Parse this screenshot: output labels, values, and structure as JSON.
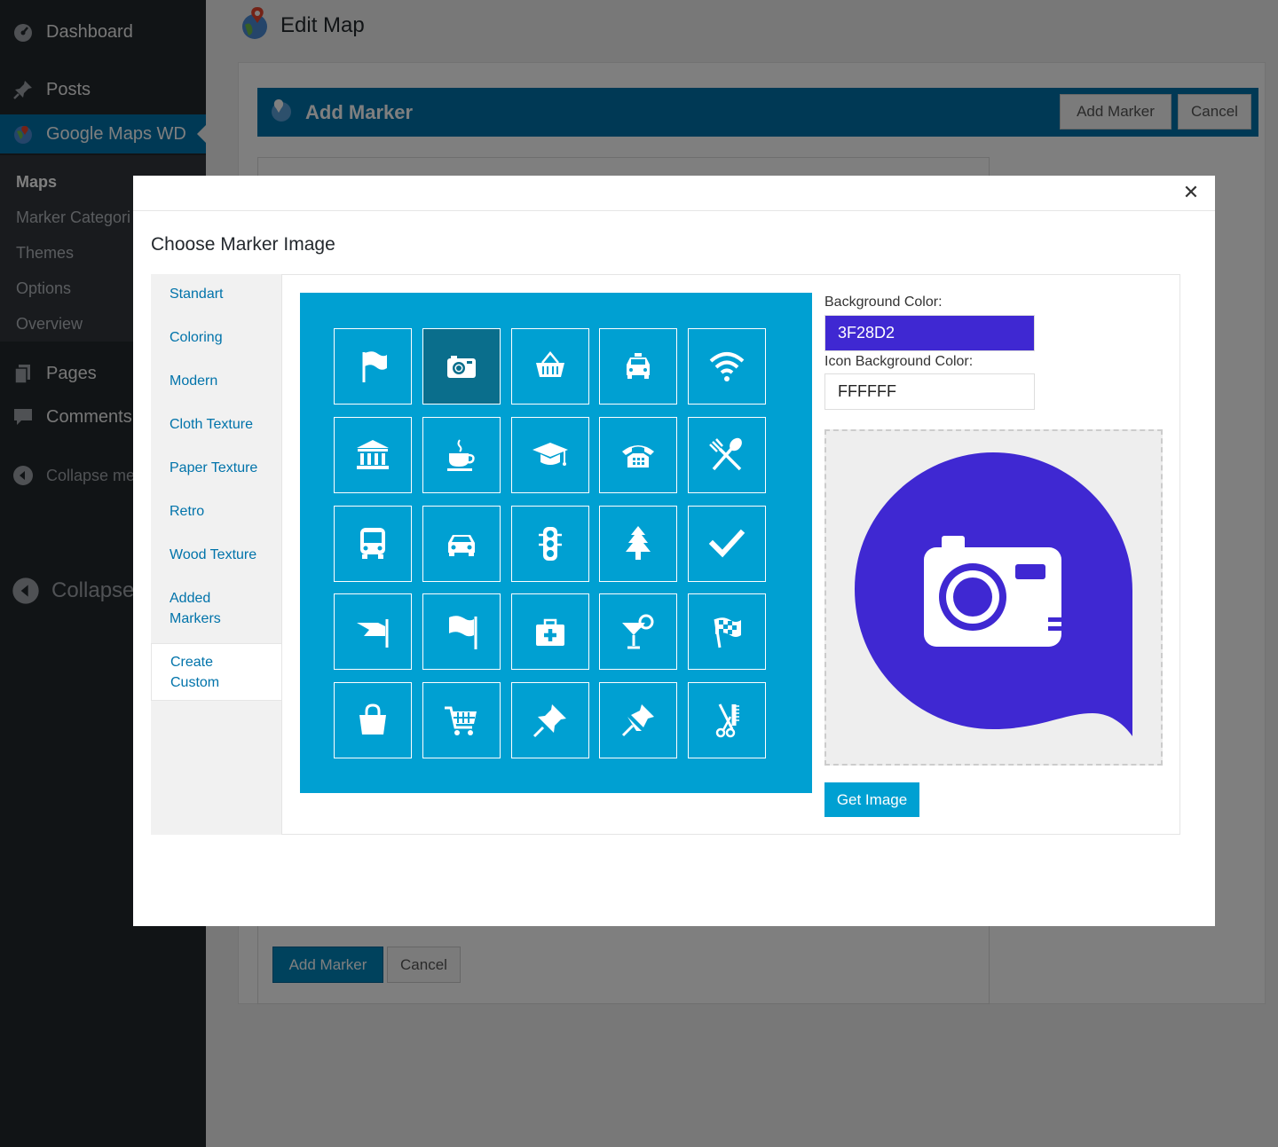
{
  "sidebar": {
    "items": [
      {
        "label": "Dashboard",
        "icon": "dashboard-icon"
      },
      {
        "label": "Posts",
        "icon": "pin-icon"
      },
      {
        "label": "Google Maps WD",
        "icon": "globe-icon"
      },
      {
        "label": "Pages",
        "icon": "pages-icon"
      },
      {
        "label": "Comments",
        "icon": "comment-icon"
      },
      {
        "label": "Collapse me",
        "icon": "collapse-icon"
      },
      {
        "label": "Collapse",
        "icon": "collapse-icon"
      }
    ],
    "submenu": [
      "Maps",
      "Marker Categori",
      "Themes",
      "Options",
      "Overview"
    ]
  },
  "page": {
    "title": "Edit Map"
  },
  "panel": {
    "header_title": "Add Marker",
    "add_marker_label": "Add Marker",
    "cancel_label": "Cancel",
    "bottom_add_label": "Add Marker",
    "bottom_cancel_label": "Cancel"
  },
  "modal": {
    "title": "Choose Marker Image",
    "close_symbol": "✕",
    "tabs": [
      "Standart",
      "Coloring",
      "Modern",
      "Cloth Texture",
      "Paper Texture",
      "Retro",
      "Wood Texture",
      "Added Markers",
      "Create Custom"
    ],
    "active_tab": "Create Custom",
    "icons": [
      "flag-icon",
      "camera-icon",
      "basket-icon",
      "taxi-icon",
      "wifi-icon",
      "bank-icon",
      "coffee-icon",
      "graduation-cap-icon",
      "phone-icon",
      "restaurant-icon",
      "bus-icon",
      "car-icon",
      "traffic-light-icon",
      "tree-icon",
      "check-icon",
      "banner-flag-icon",
      "waving-flag-icon",
      "first-aid-icon",
      "cocktail-icon",
      "checkered-flag-icon",
      "shopping-bag-icon",
      "cart-icon",
      "pushpin-icon",
      "pin-star-icon",
      "barber-icon"
    ],
    "selected_icon": "camera-icon",
    "background_color_label": "Background Color:",
    "background_color_value": "3F28D2",
    "icon_background_color_label": "Icon Background Color:",
    "icon_background_color_value": "FFFFFF",
    "get_image_label": "Get Image",
    "accent_color": "#00a0d2",
    "marker_color": "#3f28d2"
  }
}
